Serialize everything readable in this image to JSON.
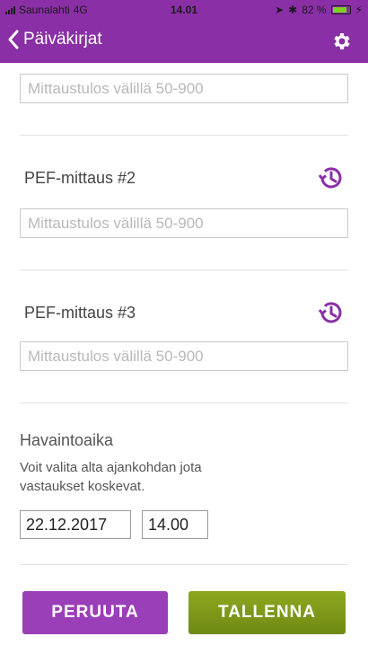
{
  "status_bar": {
    "carrier": "Saunalahti",
    "network": "4G",
    "time": "14.01",
    "battery": "82 %",
    "battery_level": 0.82
  },
  "nav": {
    "back_label": "Päiväkirjat",
    "icons": {
      "back": "chevron-left-icon",
      "settings": "gear-icon"
    }
  },
  "measurements": {
    "placeholder": "Mittaustulos välillä 50-900",
    "items": [
      {
        "label": ""
      },
      {
        "label": "PEF-mittaus #2"
      },
      {
        "label": "PEF-mittaus #3"
      }
    ],
    "history_icon": "history-icon"
  },
  "observation": {
    "title": "Havaintoaika",
    "description": "Voit valita alta ajankohdan jota vastaukset koskevat.",
    "date": "22.12.2017",
    "time": "14.00"
  },
  "actions": {
    "cancel": "PERUUTA",
    "save": "TALLENNA"
  },
  "colors": {
    "header": "#8a2fa6",
    "cancel_button": "#9b3fb8",
    "save_button": "#7f9a1a",
    "history_icon": "#8a2fa6"
  }
}
